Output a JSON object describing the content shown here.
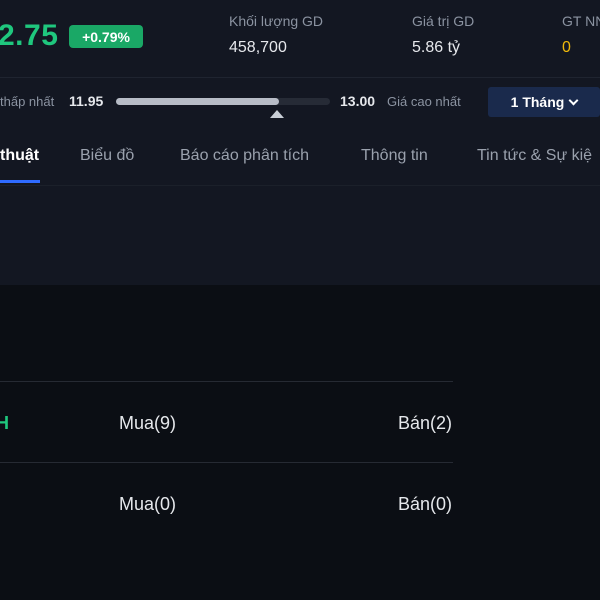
{
  "quote": {
    "price": "2.75",
    "change_percent": "+0.79%",
    "stats": [
      {
        "label": "Khối lượng GD",
        "value": "458,700"
      },
      {
        "label": "Giá trị GD",
        "value": "5.86 tỷ"
      },
      {
        "label": "GT NN",
        "value": "0"
      }
    ]
  },
  "range": {
    "low_label": "thấp nhất",
    "low_value": "11.95",
    "high_value": "13.00",
    "high_label": "Giá cao nhất",
    "position_fraction": 0.76,
    "period": "1 Tháng"
  },
  "tabs": [
    {
      "label": "thuật"
    },
    {
      "label": "Biểu đồ"
    },
    {
      "label": "Báo cáo phân tích"
    },
    {
      "label": "Thông tin"
    },
    {
      "label": "Tin tức & Sự kiệ"
    }
  ],
  "signals": [
    {
      "label": "H",
      "buy": "Mua(9)",
      "sell": "Bán(2)"
    },
    {
      "label": "",
      "buy": "Mua(0)",
      "sell": "Bán(0)"
    }
  ],
  "colors": {
    "up": "#1fc77e",
    "badge": "#1aa866",
    "accent": "#2f6bff",
    "foreign": "#f0b90b"
  }
}
